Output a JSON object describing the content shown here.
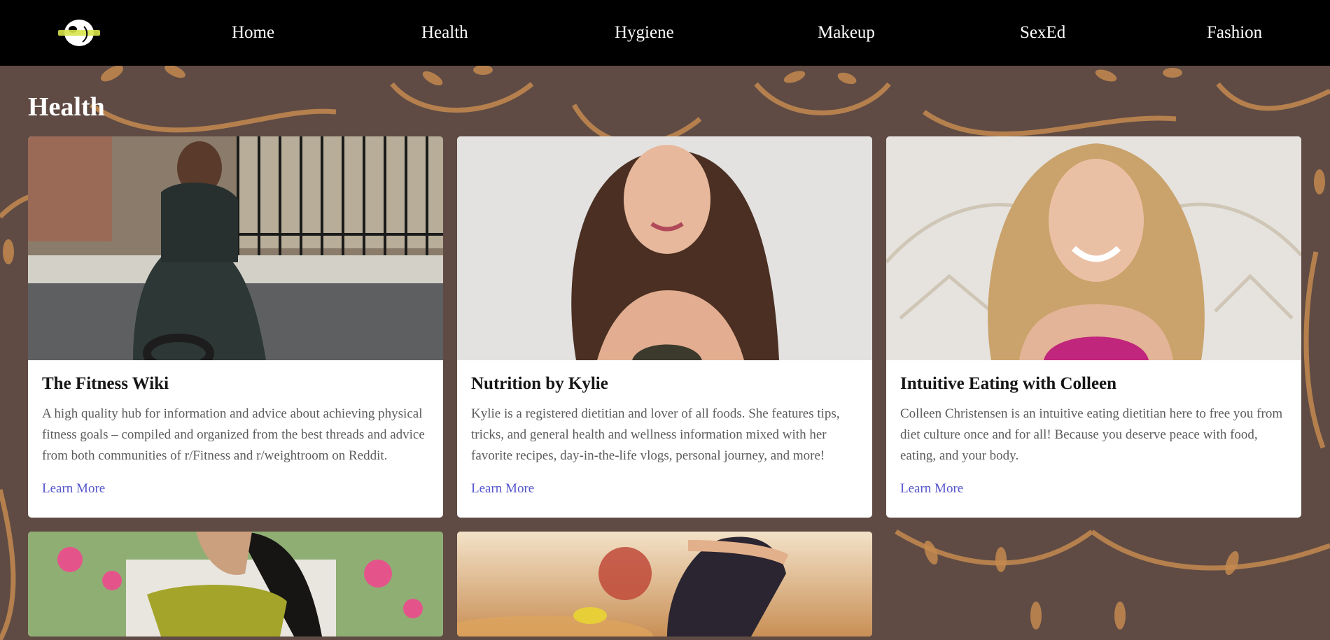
{
  "brand": {
    "logo_icon": "site-logo-icon"
  },
  "nav": {
    "items": [
      {
        "label": "Home"
      },
      {
        "label": "Health"
      },
      {
        "label": "Hygiene"
      },
      {
        "label": "Makeup"
      },
      {
        "label": "SexEd"
      },
      {
        "label": "Fashion"
      }
    ]
  },
  "page": {
    "title": "Health"
  },
  "colors": {
    "page_background": "#5f4b44",
    "pattern": "#c48a4f",
    "navbar": "#000000",
    "link": "#5555cc"
  },
  "cards": [
    {
      "title": "The Fitness Wiki",
      "description": "A high quality hub for information and advice about achieving physical fitness goals – compiled and organized from the best threads and advice from both communities of r/Fitness and r/weightroom on Reddit.",
      "link_label": "Learn More",
      "image": "woman-sitting-with-kettlebell-photo"
    },
    {
      "title": "Nutrition by Kylie",
      "description": "Kylie is a registered dietitian and lover of all foods. She features tips, tricks, and general health and wellness information mixed with her favorite recipes, day-in-the-life vlogs, personal journey, and more!",
      "link_label": "Learn More",
      "image": "smiling-woman-portrait-photo"
    },
    {
      "title": "Intuitive Eating with Colleen",
      "description": "Colleen Christensen is an intuitive eating dietitian here to free you from diet culture once and for all! Because you deserve peace with food, eating, and your body.",
      "link_label": "Learn More",
      "image": "smiling-blonde-woman-photo"
    },
    {
      "image": "woman-among-flowers-photo"
    },
    {
      "image": "woman-stretching-sunset-photo"
    }
  ]
}
